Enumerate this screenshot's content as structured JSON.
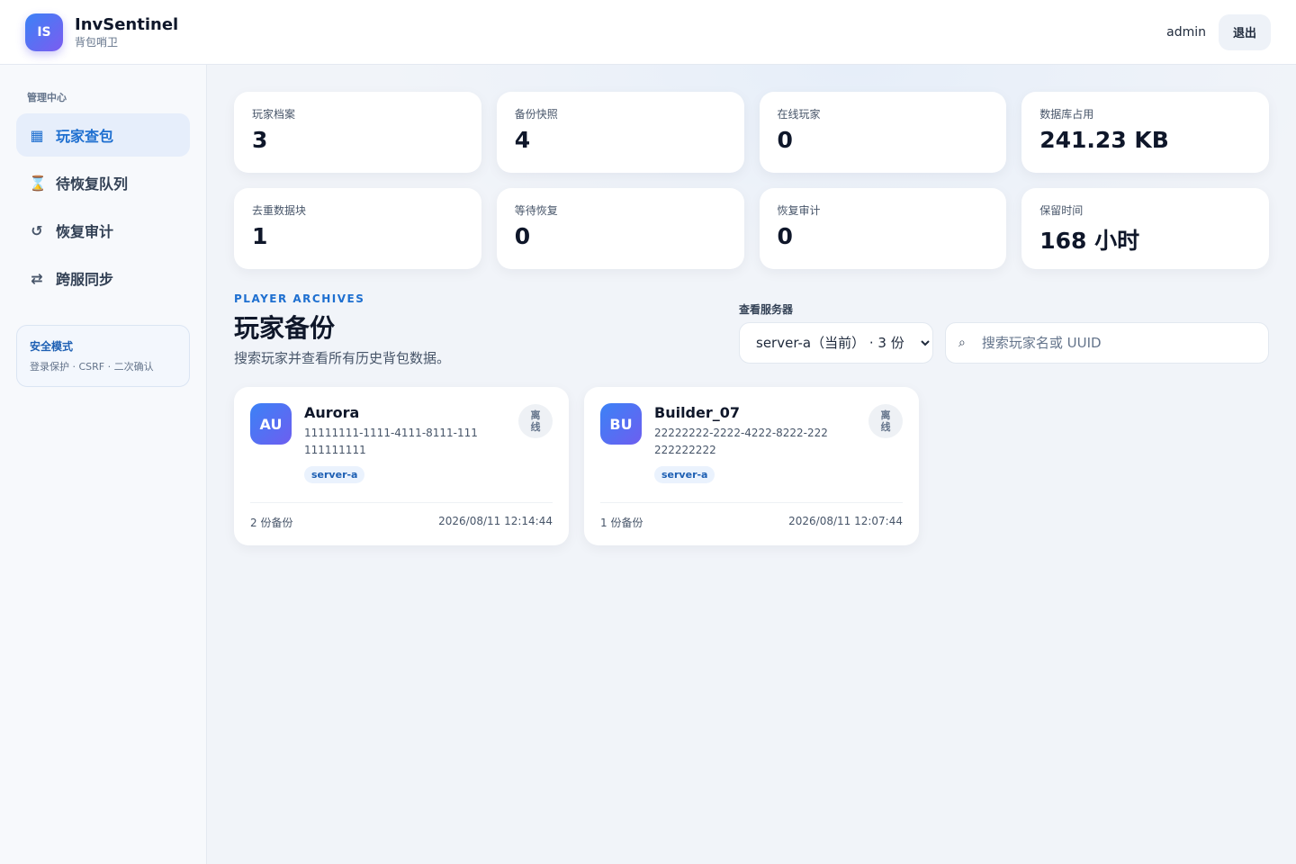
{
  "header": {
    "logo_text": "IS",
    "app_title": "InvSentinel",
    "app_subtitle": "背包哨卫",
    "user": "admin",
    "logout_label": "退出"
  },
  "sidebar": {
    "section_label": "管理中心",
    "items": [
      {
        "label": "玩家查包",
        "icon": "grid-icon",
        "glyph": "▦",
        "active": true
      },
      {
        "label": "待恢复队列",
        "icon": "hourglass-icon",
        "glyph": "⌛",
        "active": false
      },
      {
        "label": "恢复审计",
        "icon": "undo-icon",
        "glyph": "↺",
        "active": false
      },
      {
        "label": "跨服同步",
        "icon": "swap-icon",
        "glyph": "⇄",
        "active": false
      }
    ],
    "safe_mode": {
      "title": "安全模式",
      "desc": "登录保护 · CSRF · 二次确认"
    }
  },
  "stats": [
    {
      "label": "玩家档案",
      "value": "3"
    },
    {
      "label": "备份快照",
      "value": "4"
    },
    {
      "label": "在线玩家",
      "value": "0"
    },
    {
      "label": "数据库占用",
      "value": "241.23 KB"
    },
    {
      "label": "去重数据块",
      "value": "1"
    },
    {
      "label": "等待恢复",
      "value": "0"
    },
    {
      "label": "恢复审计",
      "value": "0"
    },
    {
      "label": "保留时间",
      "value": "168 小时"
    }
  ],
  "section": {
    "eyebrow": "PLAYER ARCHIVES",
    "title": "玩家备份",
    "desc": "搜索玩家并查看所有历史背包数据。"
  },
  "controls": {
    "server_label": "查看服务器",
    "server_selected": "server-a（当前） · 3 份",
    "search_placeholder": "搜索玩家名或 UUID",
    "search_value": ""
  },
  "players": [
    {
      "initials": "AU",
      "name": "Aurora",
      "uuid": "11111111-1111-4111-8111-111111111111",
      "server": "server-a",
      "status": "离线",
      "backups": "2 份备份",
      "time": "2026/08/11 12:14:44"
    },
    {
      "initials": "BU",
      "name": "Builder_07",
      "uuid": "22222222-2222-4222-8222-222222222222",
      "server": "server-a",
      "status": "离线",
      "backups": "1 份备份",
      "time": "2026/08/11 12:07:44"
    }
  ]
}
